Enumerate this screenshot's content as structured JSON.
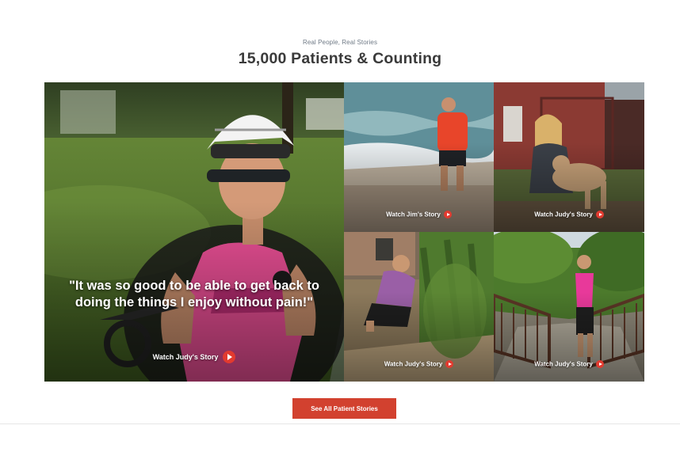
{
  "section": {
    "eyebrow": "Real People, Real Stories",
    "title": "15,000 Patients & Counting"
  },
  "featured": {
    "quote": "\"It was so good to be able to get back to doing the things I enjoy without pain!\"",
    "watch_label": "Watch Judy's Story",
    "play_icon": "play-circle-icon"
  },
  "stories": [
    {
      "watch_label": "Watch Jim's Story"
    },
    {
      "watch_label": "Watch Judy's Story"
    },
    {
      "watch_label": "Watch Judy's Story"
    },
    {
      "watch_label": "Watch Judy's Story"
    }
  ],
  "cta": {
    "label": "See All Patient Stories"
  },
  "colors": {
    "accent": "#d2412f",
    "play_icon": "#e23a2f",
    "heading": "#3a3a3a",
    "eyebrow": "#6f7a86"
  }
}
